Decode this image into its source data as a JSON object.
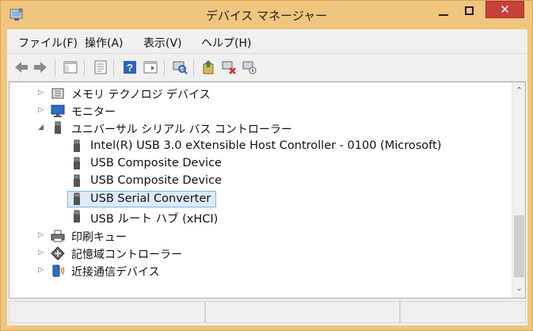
{
  "window": {
    "title": "デバイス マネージャー",
    "close_glyph": "✕"
  },
  "menu": [
    {
      "label": "ファイル(F)"
    },
    {
      "label": "操作(A)"
    },
    {
      "label": "表示(V)"
    },
    {
      "label": "ヘルプ(H)"
    }
  ],
  "toolbar": {
    "buttons": [
      "back-icon",
      "forward-icon",
      "show-hide-tree-icon",
      "properties-icon",
      "help-icon",
      "action-pane-icon",
      "scan-hardware-icon",
      "update-driver-icon",
      "uninstall-icon",
      "disable-icon"
    ]
  },
  "tree": {
    "categories": {
      "memory": "メモリ テクノロジ デバイス",
      "monitor": "モニター",
      "usb": "ユニバーサル シリアル バス コントローラー",
      "printq": "印刷キュー",
      "storage": "記憶域コントローラー",
      "proximity": "近接通信デバイス"
    },
    "usb_children": [
      "Intel(R) USB 3.0 eXtensible Host Controller - 0100 (Microsoft)",
      "USB Composite Device",
      "USB Composite Device",
      "USB Serial Converter",
      "USB ルート ハブ (xHCI)"
    ],
    "selected": "USB Serial Converter"
  },
  "scrollbar": {
    "position_fraction": 0.75
  },
  "colors": {
    "accent": "#f0c57d",
    "close": "#c7403a",
    "selection": "#dcebfc"
  }
}
